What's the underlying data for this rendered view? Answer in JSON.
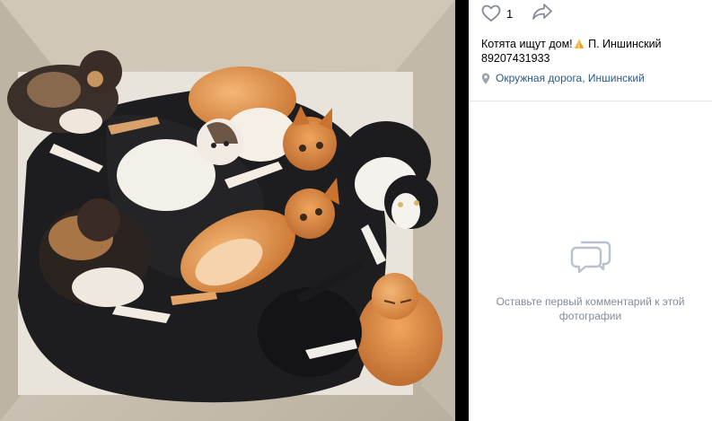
{
  "post": {
    "like_count": "1",
    "caption_text": "Котята ищут дом!",
    "caption_author_line": " П. Иншинский",
    "phone": "89207431933",
    "location": "Окружная дорога, Иншинский"
  },
  "photo": {
    "alt": "Котята на тёмном покрывале в коробке"
  },
  "comments": {
    "empty_text": "Оставьте первый комментарий к этой фотографии"
  },
  "icons": {
    "like": "heart-outline-icon",
    "share": "share-arrow-icon",
    "caption_emoji": "folded-hands-icon",
    "location": "map-pin-icon",
    "empty_comments": "comment-bubbles-icon"
  },
  "colors": {
    "link": "#2a5885",
    "muted": "#818c99",
    "icon": "#828a99",
    "divider": "#e7e8ec"
  }
}
